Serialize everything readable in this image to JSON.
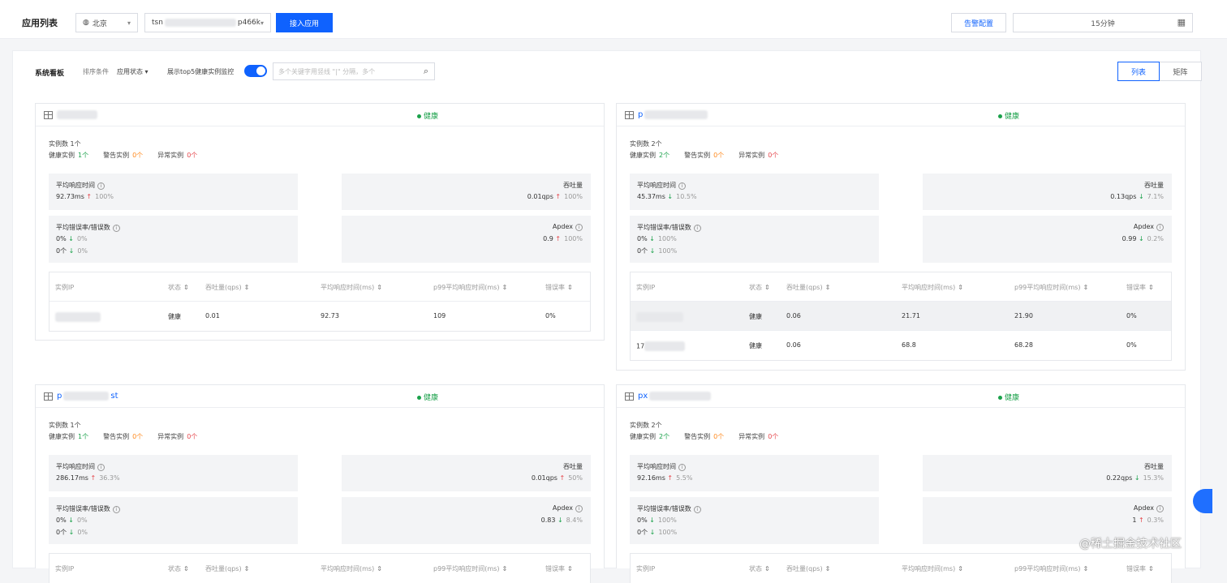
{
  "header": {
    "title": "应用列表",
    "region": "北京",
    "app_prefix": "tsn",
    "app_suffix": "p466k",
    "add_app_label": "接入应用",
    "alert_label": "告警配置",
    "time_range": "15分钟"
  },
  "panel": {
    "title": "系统看板",
    "filter_label": "排序条件",
    "filter_value": "应用状态",
    "toggle_label": "展示top5健康实例监控",
    "toggle_on": true,
    "search_placeholder": "多个关键字用竖线 \"|\" 分隔，多个",
    "view_list": "列表",
    "view_matrix": "矩阵"
  },
  "labels": {
    "healthy": "健康",
    "instance_count": "实例数",
    "healthy_inst": "健康实例",
    "warn_inst": "警告实例",
    "abnormal_inst": "异常实例",
    "avg_resp": "平均响应时间",
    "throughput": "吞吐量",
    "avg_err_rate": "平均错误率/错误数",
    "apdex": "Apdex",
    "col_ip": "实例IP",
    "col_status": "状态",
    "col_tp": "吞吐量(qps)",
    "col_resp": "平均响应时间(ms)",
    "col_p99": "p99平均响应时间(ms)",
    "col_err": "错误率"
  },
  "cards": [
    {
      "name_prefix": "",
      "name_suffix": "",
      "count": "1个",
      "healthy": "1个",
      "warn": "0个",
      "abnormal": "0个",
      "resp": "92.73ms",
      "resp_dir": "up",
      "resp_chg": "100%",
      "tp": "0.01qps",
      "tp_dir": "up",
      "tp_chg": "100%",
      "err_rate": "0%",
      "err_rate_chg": "0%",
      "err_cnt": "0个",
      "err_cnt_chg": "0%",
      "apdex": "0.9",
      "apdex_dir": "up",
      "apdex_chg": "100%",
      "rows": [
        {
          "status": "健康",
          "tp": "0.01",
          "resp": "92.73",
          "p99": "109",
          "err": "0%"
        }
      ]
    },
    {
      "name_prefix": "p",
      "name_suffix": "",
      "count": "2个",
      "healthy": "2个",
      "warn": "0个",
      "abnormal": "0个",
      "resp": "45.37ms",
      "resp_dir": "down",
      "resp_chg": "10.5%",
      "tp": "0.13qps",
      "tp_dir": "down",
      "tp_chg": "7.1%",
      "err_rate": "0%",
      "err_rate_chg": "100%",
      "err_cnt": "0个",
      "err_cnt_chg": "100%",
      "apdex": "0.99",
      "apdex_dir": "down",
      "apdex_chg": "0.2%",
      "rows": [
        {
          "ip_prefix": "",
          "ip_suffix": "",
          "status": "健康",
          "tp": "0.06",
          "resp": "21.71",
          "p99": "21.90",
          "err": "0%"
        },
        {
          "ip_prefix": "17",
          "ip_suffix": "",
          "status": "健康",
          "tp": "0.06",
          "resp": "68.8",
          "p99": "68.28",
          "err": "0%"
        }
      ]
    },
    {
      "name_prefix": "p",
      "name_suffix": "st",
      "count": "1个",
      "healthy": "1个",
      "warn": "0个",
      "abnormal": "0个",
      "resp": "286.17ms",
      "resp_dir": "up",
      "resp_chg": "36.3%",
      "tp": "0.01qps",
      "tp_dir": "up",
      "tp_chg": "50%",
      "err_rate": "0%",
      "err_rate_chg": "0%",
      "err_cnt": "0个",
      "err_cnt_chg": "0%",
      "apdex": "0.83",
      "apdex_dir": "down",
      "apdex_chg": "8.4%"
    },
    {
      "name_prefix": "px",
      "name_suffix": "",
      "count": "2个",
      "healthy": "2个",
      "warn": "0个",
      "abnormal": "0个",
      "resp": "92.16ms",
      "resp_dir": "up",
      "resp_chg": "5.5%",
      "tp": "0.22qps",
      "tp_dir": "down",
      "tp_chg": "15.3%",
      "err_rate": "0%",
      "err_rate_chg": "100%",
      "err_cnt": "0个",
      "err_cnt_chg": "100%",
      "apdex": "1",
      "apdex_dir": "up",
      "apdex_chg": "0.3%"
    }
  ],
  "watermark": "@稀土掘金技术社区",
  "colors": {
    "primary": "#0f62fe",
    "healthy": "#1aa14a",
    "warn": "#ff8a1f",
    "abnormal": "#e5484d",
    "up": "#e5484d",
    "down": "#1aa14a"
  }
}
